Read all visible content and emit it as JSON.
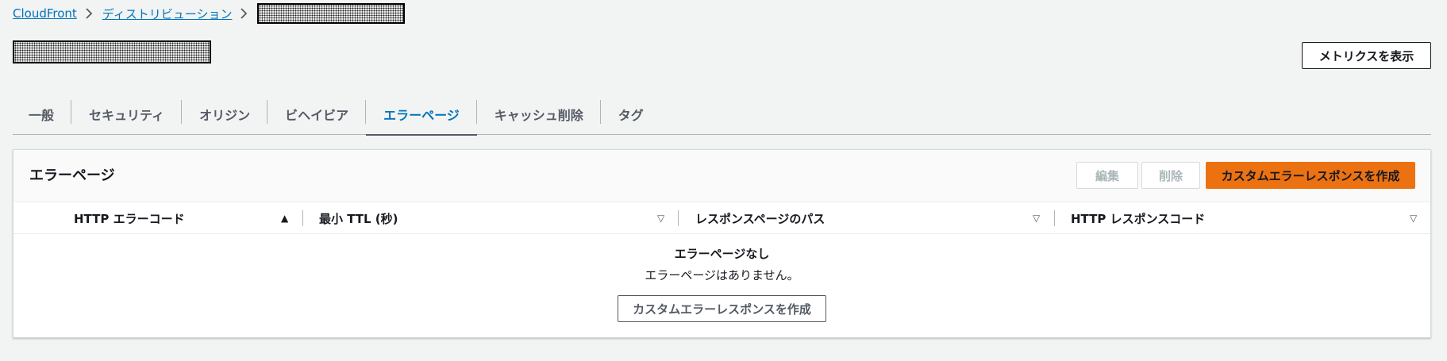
{
  "breadcrumb": {
    "items": [
      {
        "label": "CloudFront"
      },
      {
        "label": "ディストリビューション"
      }
    ]
  },
  "header": {
    "metrics_button": "メトリクスを表示"
  },
  "tabs": [
    {
      "label": "一般",
      "active": false
    },
    {
      "label": "セキュリティ",
      "active": false
    },
    {
      "label": "オリジン",
      "active": false
    },
    {
      "label": "ビヘイビア",
      "active": false
    },
    {
      "label": "エラーページ",
      "active": true
    },
    {
      "label": "キャッシュ削除",
      "active": false
    },
    {
      "label": "タグ",
      "active": false
    }
  ],
  "panel": {
    "title": "エラーページ",
    "edit_button": "編集",
    "delete_button": "削除",
    "create_button": "カスタムエラーレスポンスを作成"
  },
  "table": {
    "columns": [
      {
        "label": "HTTP エラーコード",
        "sort": "ascending"
      },
      {
        "label": "最小 TTL (秒)",
        "sort": "none"
      },
      {
        "label": "レスポンスページのパス",
        "sort": "none"
      },
      {
        "label": "HTTP レスポンスコード",
        "sort": "none"
      }
    ],
    "sort_glyphs": {
      "ascending": "▲",
      "none": "▽"
    },
    "empty": {
      "title": "エラーページなし",
      "description": "エラーページはありません。",
      "button": "カスタムエラーレスポンスを作成"
    }
  },
  "colors": {
    "link": "#0073bb",
    "primary": "#ec7211",
    "background": "#f2f3f3"
  },
  "icons": {
    "breadcrumb_separator": "chevron-right-icon",
    "sort_ascending": "caret-up-icon",
    "sort_unsorted": "caret-down-outline-icon"
  }
}
